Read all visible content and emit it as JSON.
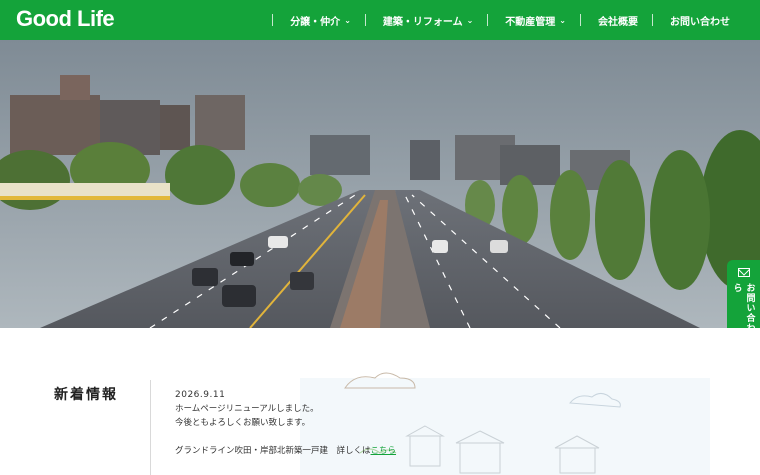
{
  "header": {
    "logo": "Good Life",
    "nav": [
      {
        "label": "分譲・仲介",
        "dropdown": true
      },
      {
        "label": "建築・リフォーム",
        "dropdown": true
      },
      {
        "label": "不動産管理",
        "dropdown": true
      },
      {
        "label": "会社概要",
        "dropdown": false
      },
      {
        "label": "お問い合わせ",
        "dropdown": false
      }
    ]
  },
  "side_contact": {
    "label": "お問い合わせはこちら",
    "icon": "mail-icon"
  },
  "news": {
    "heading": "新着情報",
    "date": "2026.9.11",
    "line1": "ホームページリニューアルしました。",
    "line2": "今後ともよろしくお願い致します。",
    "line3": "グランドライン吹田・岸部北新築一戸建　詳しくは",
    "link": "こちら"
  },
  "colors": {
    "brand": "#14a33a",
    "hero_sky": "#8d9aa3"
  }
}
